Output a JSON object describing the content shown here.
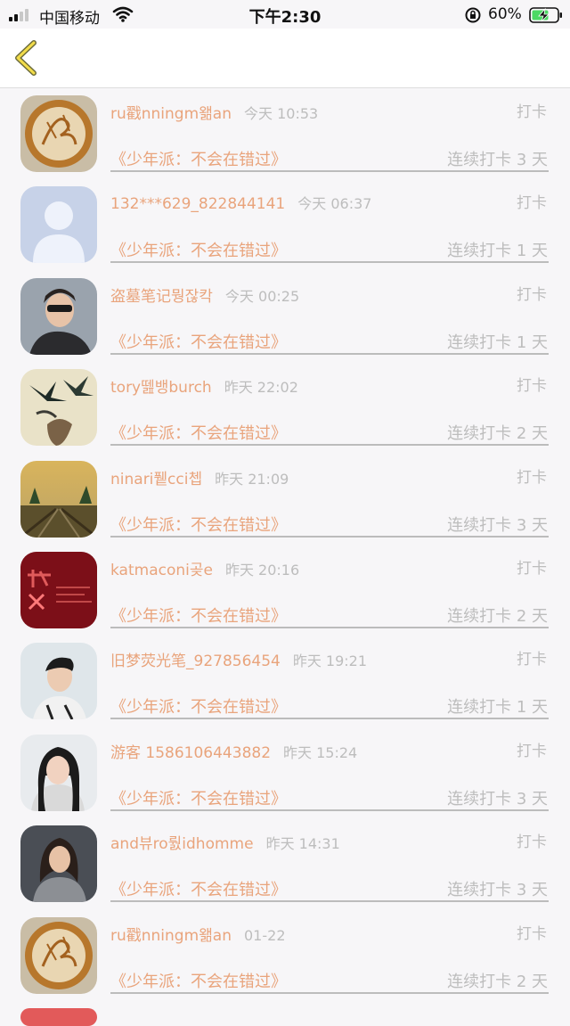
{
  "status_bar": {
    "carrier": "中国移动",
    "time": "下午2:30",
    "battery": "60%"
  },
  "nav": {
    "back_icon": "chevron-left-icon"
  },
  "records": [
    {
      "name": "ru戳nningm왦an",
      "time": "今天 10:53",
      "action": "打卡",
      "book": "《少年派：不会在错过》",
      "streak": "连续打卡 3 天",
      "avatar": "latte-art"
    },
    {
      "name": "132***629_822844141",
      "time": "今天 06:37",
      "action": "打卡",
      "book": "《少年派：不会在错过》",
      "streak": "连续打卡 1 天",
      "avatar": "default-person"
    },
    {
      "name": "盗墓笔记뭥잖칵",
      "time": "今天 00:25",
      "action": "打卡",
      "book": "《少年派：不会在错过》",
      "streak": "连续打卡 1 天",
      "avatar": "man-sunglasses"
    },
    {
      "name": "tory뗊뱅burch",
      "time": "昨天 22:02",
      "action": "打卡",
      "book": "《少年派：不会在错过》",
      "streak": "连续打卡 2 天",
      "avatar": "swallows"
    },
    {
      "name": "ninari퓉cci쳅",
      "time": "昨天 21:09",
      "action": "打卡",
      "book": "《少年派：不会在错过》",
      "streak": "连续打卡 3 天",
      "avatar": "railway"
    },
    {
      "name": "katmaconi곶e",
      "time": "昨天 20:16",
      "action": "打卡",
      "book": "《少年派：不会在错过》",
      "streak": "连续打卡 2 天",
      "avatar": "red-text"
    },
    {
      "name": "旧梦荧光笔_927856454",
      "time": "昨天 19:21",
      "action": "打卡",
      "book": "《少年派：不会在错过》",
      "streak": "连续打卡 1 天",
      "avatar": "young-man"
    },
    {
      "name": "游客 1586106443882",
      "time": "昨天 15:24",
      "action": "打卡",
      "book": "《少年派：不会在错过》",
      "streak": "连续打卡 3 天",
      "avatar": "woman"
    },
    {
      "name": "and뷰ro뤐idhomme",
      "time": "昨天 14:31",
      "action": "打卡",
      "book": "《少年派：不会在错过》",
      "streak": "连续打卡 3 天",
      "avatar": "woman-dark"
    },
    {
      "name": "ru戳nningm왦an",
      "time": "01-22",
      "action": "打卡",
      "book": "《少年派：不会在错过》",
      "streak": "连续打卡 2 天",
      "avatar": "latte-art"
    }
  ]
}
